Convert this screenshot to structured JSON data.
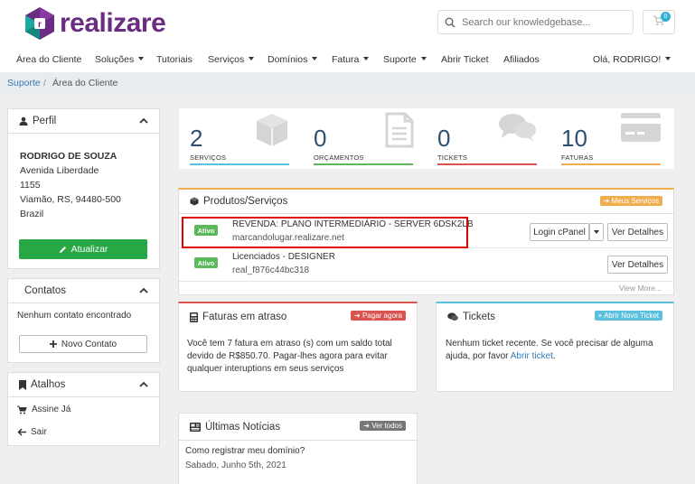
{
  "brand": {
    "name": "realizare"
  },
  "search": {
    "placeholder": "Search our knowledgebase..."
  },
  "cart": {
    "count": "0"
  },
  "nav": {
    "items": [
      {
        "label": "Área do Cliente",
        "dropdown": false
      },
      {
        "label": "Soluções",
        "dropdown": true
      },
      {
        "label": "Tutoriais",
        "dropdown": false
      },
      {
        "label": "Serviços",
        "dropdown": true
      },
      {
        "label": "Domínios",
        "dropdown": true
      },
      {
        "label": "Fatura",
        "dropdown": true
      },
      {
        "label": "Suporte",
        "dropdown": true
      },
      {
        "label": "Abrir Ticket",
        "dropdown": false
      },
      {
        "label": "Afiliados",
        "dropdown": false
      }
    ],
    "greeting": "Olá, RODRIGO!"
  },
  "breadcrumb": {
    "root": "Suporte",
    "separator": "/",
    "current": "Área do Cliente"
  },
  "profile": {
    "title": "Perfil",
    "name": "RODRIGO DE SOUZA",
    "address1": "Avenida Liberdade",
    "address2": "1155",
    "city": "Viamão, RS, 94480-500",
    "country": "Brazil",
    "update_label": "Atualizar"
  },
  "contacts": {
    "title": "Contatos",
    "empty": "Nenhum contato encontrado",
    "new_label": "Novo Contato"
  },
  "shortcuts": {
    "title": "Atalhos",
    "items": [
      "Assine Já",
      "Sair"
    ]
  },
  "stats": [
    {
      "value": "2",
      "label": "SERVIÇOS",
      "color": "#5bc0de",
      "icon": "cube-icon"
    },
    {
      "value": "0",
      "label": "ORÇAMENTOS",
      "color": "#5cb85c",
      "icon": "document-icon"
    },
    {
      "value": "0",
      "label": "TICKETS",
      "color": "#d9534f",
      "icon": "comments-icon"
    },
    {
      "value": "10",
      "label": "FATURAS",
      "color": "#f0ad4e",
      "icon": "credit-card-icon"
    }
  ],
  "products": {
    "title": "Produtos/Serviços",
    "my_services_label": "Meus Serviços",
    "items": [
      {
        "status": "Ativo",
        "name": "REVENDA: PLANO INTERMEDIÁRIO - SERVER 6DSK2LB",
        "domain": "marcandolugar.realizare.net",
        "login_label": "Login cPanel",
        "details_label": "Ver Detalhes"
      },
      {
        "status": "Ativo",
        "name": "Licenciados - DESIGNER",
        "domain": "real_f876c44bc318",
        "details_label": "Ver Detalhes"
      }
    ],
    "view_more": "View More..."
  },
  "invoices": {
    "title": "Faturas em atraso",
    "pay_label": "Pagar agora",
    "text": "Você tem 7 fatura em atraso (s) com um saldo total devido de R$850.70. Pagar-lhes agora para evitar qualquer interuptions em seus serviços"
  },
  "tickets": {
    "title": "Tickets",
    "open_label": "Abrir Novo Ticket",
    "text_prefix": "Nenhum ticket recente. Se você precisar de alguma ajuda, por favor ",
    "link": "Abrir ticket",
    "text_suffix": "."
  },
  "news": {
    "title": "Últimas Notícias",
    "all_label": "Ver todos",
    "items": [
      {
        "title": "Como registrar meu domínio?",
        "date": "Sabado, Junho 5th, 2021"
      }
    ]
  },
  "colors": {
    "brand": "#6b2d82",
    "accent_blue": "#337ab7",
    "green": "#28a745",
    "orange": "#f0ad4e",
    "red": "#d9534f",
    "highlight": "#e00000"
  }
}
